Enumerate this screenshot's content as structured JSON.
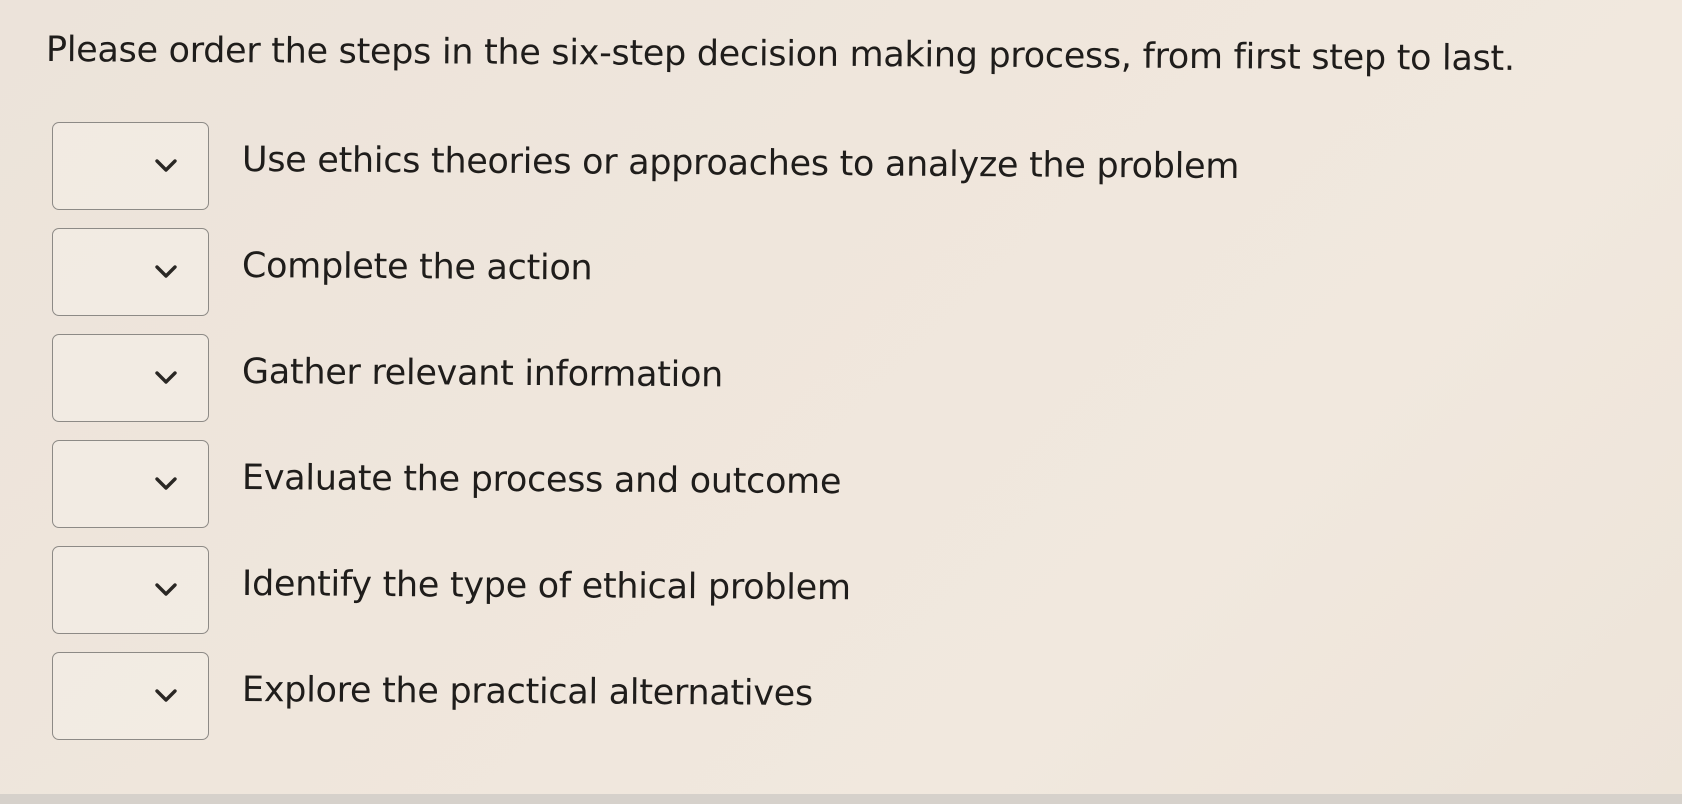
{
  "question": {
    "text": "Please order the steps in the six-step decision making process, from first step to last."
  },
  "steps": [
    {
      "label": "Use ethics theories or approaches to analyze the problem",
      "selected": ""
    },
    {
      "label": "Complete the action",
      "selected": ""
    },
    {
      "label": "Gather relevant information",
      "selected": ""
    },
    {
      "label": "Evaluate the process and outcome",
      "selected": ""
    },
    {
      "label": "Identify the type of ethical problem",
      "selected": ""
    },
    {
      "label": "Explore the practical alternatives",
      "selected": ""
    }
  ],
  "icons": {
    "dropdown": "chevron-down-icon"
  },
  "colors": {
    "background": "#efe6dc",
    "text": "#1f1d1b",
    "border": "#8d8a86"
  }
}
